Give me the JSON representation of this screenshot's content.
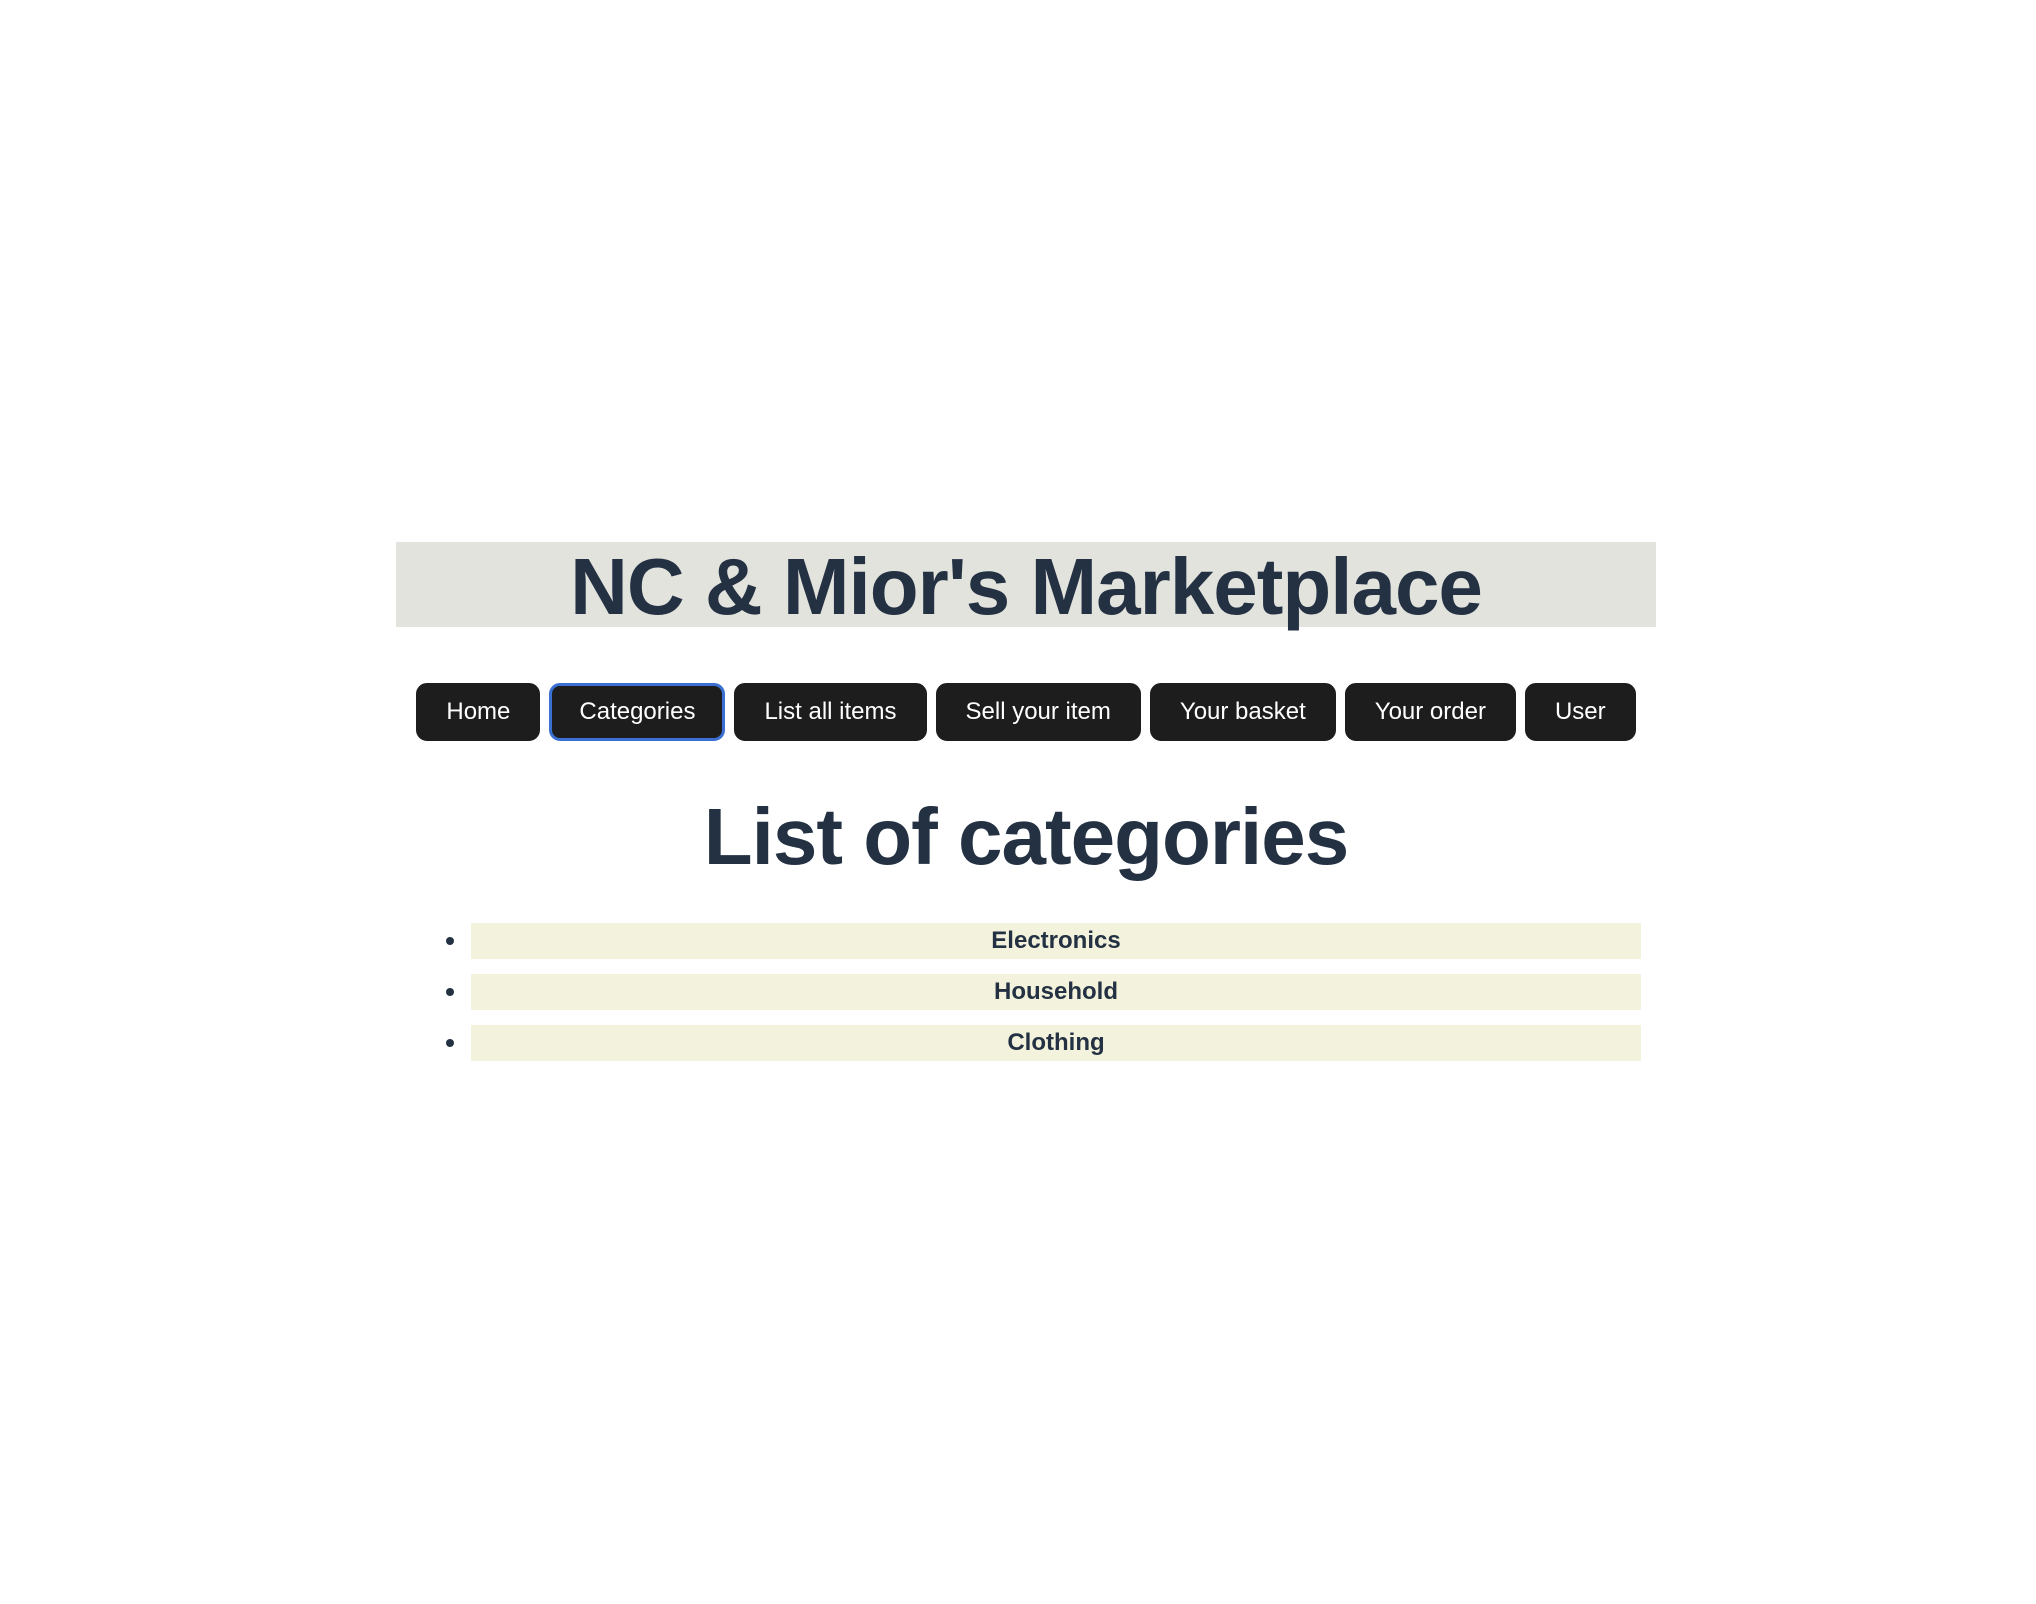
{
  "site": {
    "title": "NC & Mior's Marketplace"
  },
  "nav": {
    "items": [
      {
        "label": "Home",
        "focused": false
      },
      {
        "label": "Categories",
        "focused": true
      },
      {
        "label": "List all items",
        "focused": false
      },
      {
        "label": "Sell your item",
        "focused": false
      },
      {
        "label": "Your basket",
        "focused": false
      },
      {
        "label": "Your order",
        "focused": false
      },
      {
        "label": "User",
        "focused": false
      }
    ]
  },
  "main": {
    "heading": "List of categories",
    "categories": [
      "Electronics",
      "Household",
      "Clothing"
    ]
  },
  "colors": {
    "text": "#233142",
    "banner_bg": "#e3e3de",
    "button_bg": "#1d1d1d",
    "focus_ring": "#3b6fd1",
    "category_bg": "#f3f3dd"
  }
}
